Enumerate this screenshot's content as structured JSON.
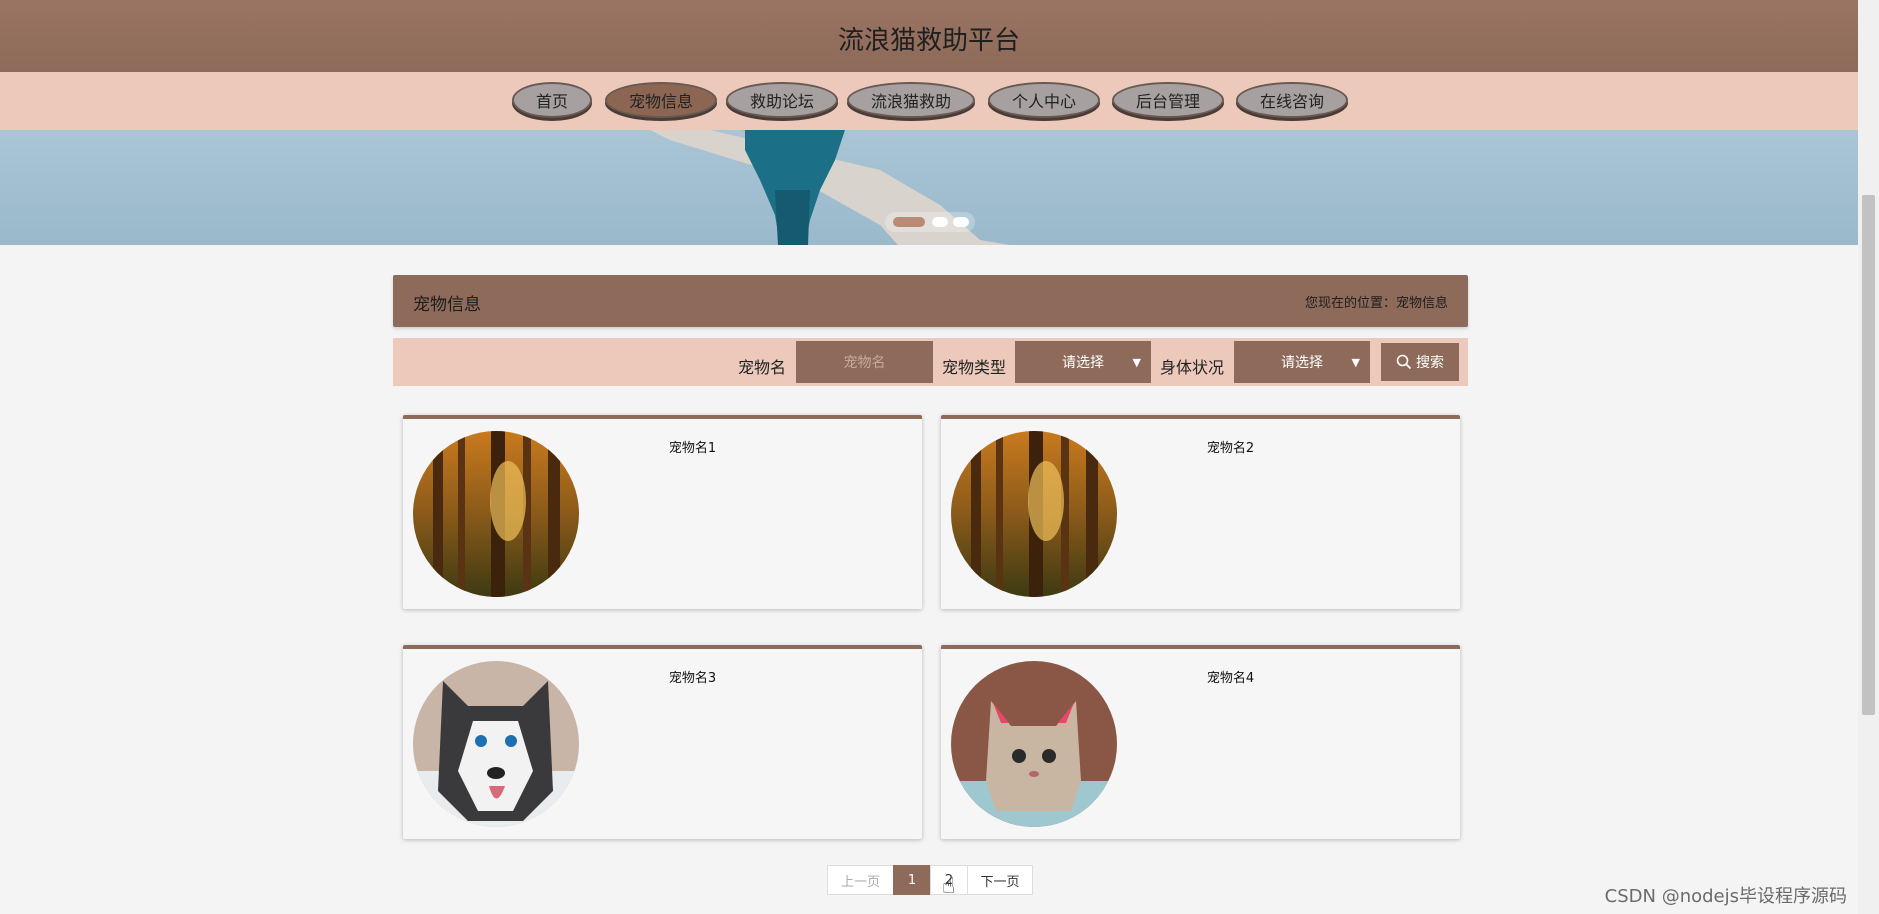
{
  "header": {
    "title": "流浪猫救助平台"
  },
  "nav": {
    "items": [
      {
        "label": "首页",
        "active": false
      },
      {
        "label": "宠物信息",
        "active": true
      },
      {
        "label": "救助论坛",
        "active": false
      },
      {
        "label": "流浪猫救助",
        "active": false
      },
      {
        "label": "个人中心",
        "active": false
      },
      {
        "label": "后台管理",
        "active": false
      },
      {
        "label": "在线咨询",
        "active": false
      }
    ]
  },
  "breadcrumb": {
    "title": "宠物信息",
    "location_label": "您现在的位置：",
    "location_value": "宠物信息"
  },
  "search": {
    "name_label": "宠物名",
    "name_placeholder": "宠物名",
    "type_label": "宠物类型",
    "type_value": "请选择",
    "status_label": "身体状况",
    "status_value": "请选择",
    "button_label": "搜索"
  },
  "cards": [
    {
      "name": "宠物名1",
      "image": "forest"
    },
    {
      "name": "宠物名2",
      "image": "forest"
    },
    {
      "name": "宠物名3",
      "image": "husky"
    },
    {
      "name": "宠物名4",
      "image": "cat"
    }
  ],
  "pagination": {
    "prev": "上一页",
    "current": "1",
    "next_page": "2",
    "next": "下一页"
  },
  "watermark": "CSDN @nodejs毕设程序源码",
  "colors": {
    "brand": "#8d6a59",
    "nav_bg": "#ecc9bb",
    "banner_sky": "#a9c5d6"
  }
}
